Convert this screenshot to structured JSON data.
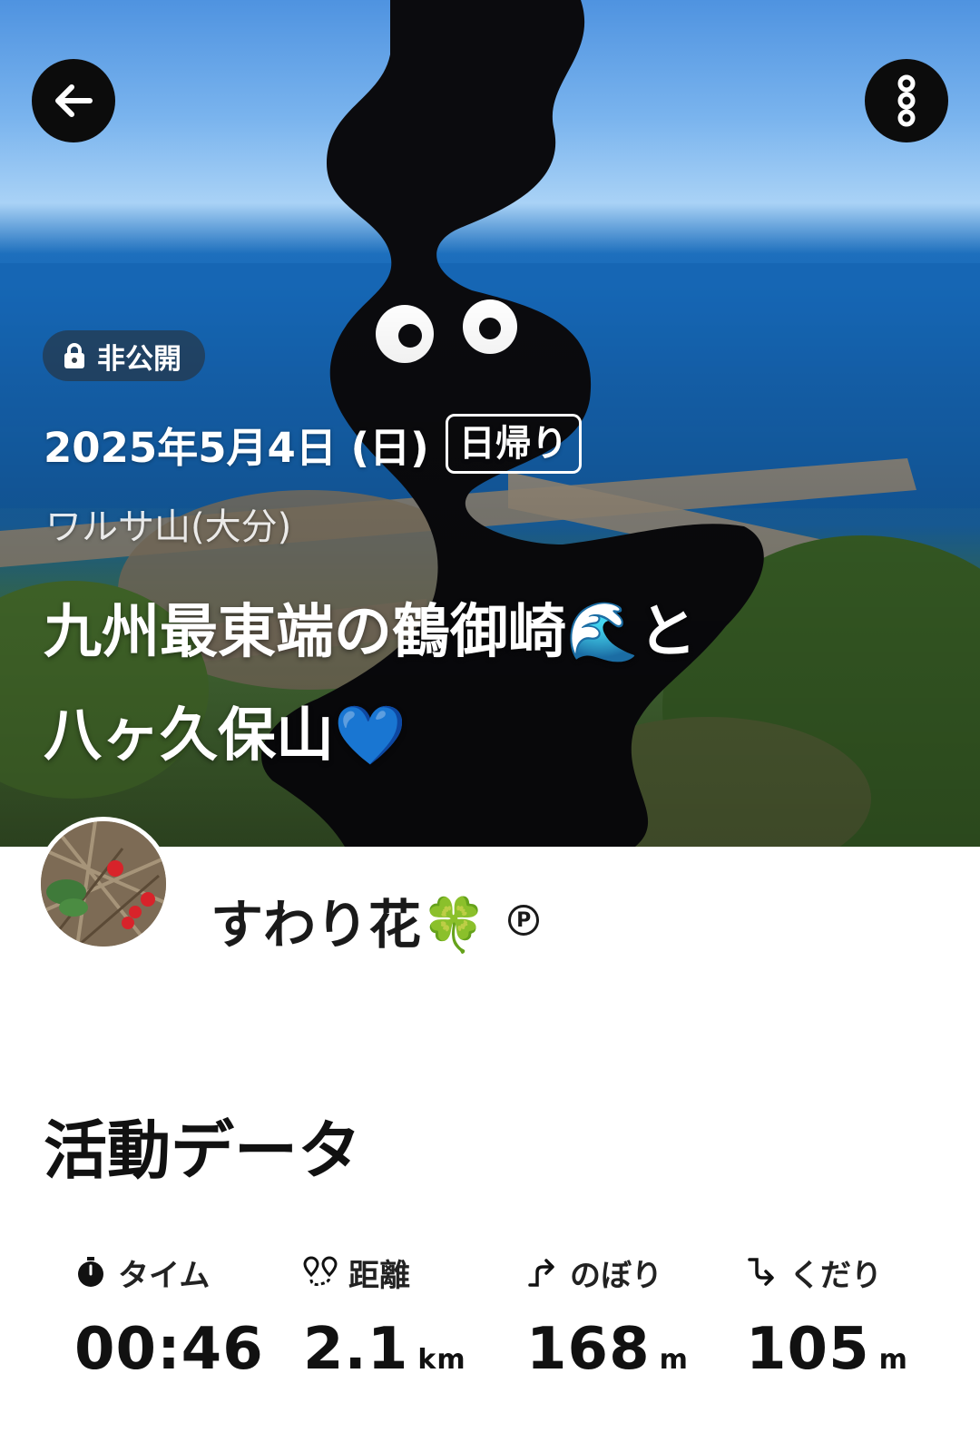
{
  "header": {
    "back_icon": "arrow-left-icon",
    "more_icon": "more-vertical-icon",
    "privacy": {
      "icon": "lock-icon",
      "label": "非公開"
    },
    "date": "2025年5月4日 (日)",
    "trip_type": "日帰り",
    "mountain": "ワルサ山(大分)",
    "title_line1": "九州最東端の鶴御崎🌊と",
    "title_line2": "八ヶ久保山💙"
  },
  "user": {
    "name": "すわり花🍀",
    "badge": "P"
  },
  "activity": {
    "section_title": "活動データ",
    "stats": [
      {
        "icon": "stopwatch-icon",
        "label": "タイム",
        "value": "00:46",
        "unit": ""
      },
      {
        "icon": "route-pin-icon",
        "label": "距離",
        "value": "2.1",
        "unit": "km"
      },
      {
        "icon": "ascent-icon",
        "label": "のぼり",
        "value": "168",
        "unit": "m"
      },
      {
        "icon": "descent-icon",
        "label": "くだり",
        "value": "105",
        "unit": "m"
      }
    ]
  }
}
